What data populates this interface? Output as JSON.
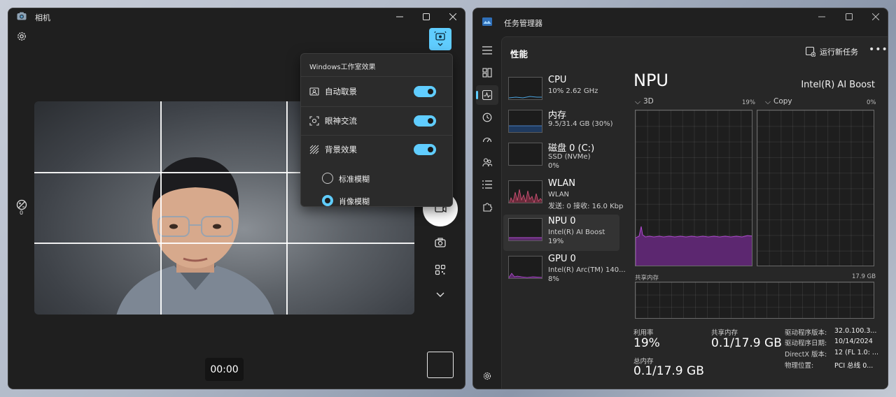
{
  "camera": {
    "title": "相机",
    "effects_panel": {
      "title": "Windows工作室效果",
      "items": [
        {
          "label": "自动取景",
          "on": true
        },
        {
          "label": "眼神交流",
          "on": true
        },
        {
          "label": "背景效果",
          "on": true
        }
      ],
      "background_options": [
        {
          "label": "标准模糊",
          "selected": false
        },
        {
          "label": "肖像模糊",
          "selected": true
        }
      ]
    },
    "exposure_value": "0",
    "timer": "00:00",
    "accent": "#60cdff"
  },
  "taskmgr": {
    "title": "任务管理器",
    "page_title": "性能",
    "run_new_task": "运行新任务",
    "resources": [
      {
        "name": "CPU",
        "sub1": "10% 2.62 GHz",
        "sub2": ""
      },
      {
        "name": "内存",
        "sub1": "9.5/31.4 GB (30%)",
        "sub2": ""
      },
      {
        "name": "磁盘 0 (C:)",
        "sub1": "SSD (NVMe)",
        "sub2": "0%"
      },
      {
        "name": "WLAN",
        "sub1": "WLAN",
        "sub2": "发送: 0 接收: 16.0 Kbp"
      },
      {
        "name": "NPU 0",
        "sub1": "Intel(R) AI Boost",
        "sub2": "19%"
      },
      {
        "name": "GPU 0",
        "sub1": "Intel(R) Arc(TM) 140...",
        "sub2": "8%"
      }
    ],
    "detail": {
      "title": "NPU",
      "model": "Intel(R) AI Boost",
      "engine1": {
        "label": "3D",
        "percent": "19%"
      },
      "engine2": {
        "label": "Copy",
        "percent": "0%"
      },
      "shared_mem_label": "共享内存",
      "shared_mem_max": "17.9 GB",
      "stats": {
        "util_label": "利用率",
        "util_value": "19%",
        "shared_label": "共享内存",
        "shared_value": "0.1/17.9 GB",
        "total_label": "总内存",
        "total_value": "0.1/17.9 GB"
      },
      "info": [
        {
          "k": "驱动程序版本:",
          "v": "32.0.100.3..."
        },
        {
          "k": "驱动程序日期:",
          "v": "10/14/2024"
        },
        {
          "k": "DirectX 版本:",
          "v": "12 (FL 1.0: ..."
        },
        {
          "k": "物理位置:",
          "v": "PCI 总线 0..."
        }
      ]
    },
    "npu_color": "#b04bd0"
  }
}
